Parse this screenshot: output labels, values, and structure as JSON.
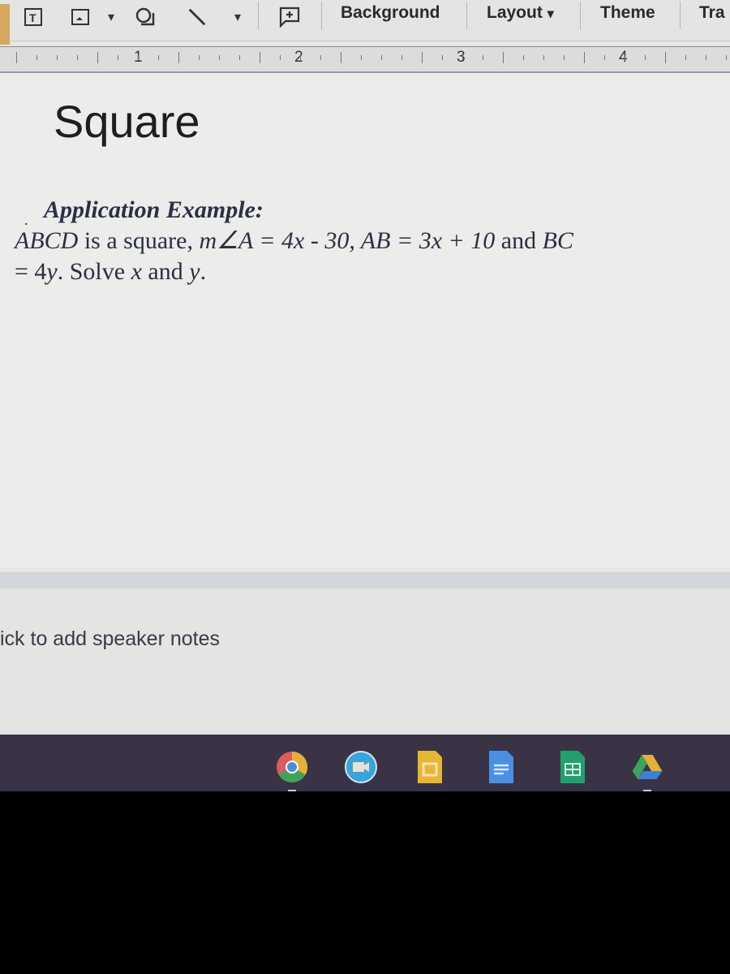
{
  "toolbar": {
    "tools": [
      {
        "name": "text-box-tool",
        "icon": "text-box-icon"
      },
      {
        "name": "image-tool",
        "icon": "image-icon"
      },
      {
        "name": "shape-tool",
        "icon": "shape-icon"
      },
      {
        "name": "line-tool",
        "icon": "line-icon"
      },
      {
        "name": "comment-tool",
        "icon": "add-comment-icon"
      }
    ],
    "background_label": "Background",
    "layout_label": "Layout",
    "theme_label": "Theme",
    "transition_label": "Tra"
  },
  "ruler": {
    "numbers": [
      "1",
      "2",
      "3",
      "4"
    ]
  },
  "slide": {
    "title": "Square",
    "heading": "Application Example:",
    "line1_a": "ABCD",
    "line1_b": " is a square, ",
    "line1_c": "m∠A",
    "line1_d": "  = 4x - 30, AB = 3x + 10",
    "line1_e": " and ",
    "line1_f": "BC",
    "line2_a": "= 4",
    "line2_b": "y",
    "line2_c": ". Solve ",
    "line2_d": "x",
    "line2_e": " and ",
    "line2_f": "y",
    "line2_g": "."
  },
  "notes": {
    "placeholder": "ick to add speaker notes"
  },
  "shelf": {
    "apps": [
      {
        "name": "Chrome",
        "icon": "chrome-icon",
        "color": "#4a8fd6"
      },
      {
        "name": "Meet",
        "icon": "video-call-icon",
        "color": "#3aa3d8"
      },
      {
        "name": "Slides",
        "icon": "slides-icon",
        "color": "#e6b634"
      },
      {
        "name": "Docs",
        "icon": "docs-icon",
        "color": "#4a90e2"
      },
      {
        "name": "Sheets",
        "icon": "sheets-icon",
        "color": "#22a06b"
      },
      {
        "name": "Drive",
        "icon": "drive-icon",
        "color": "#3b82d6"
      }
    ]
  }
}
